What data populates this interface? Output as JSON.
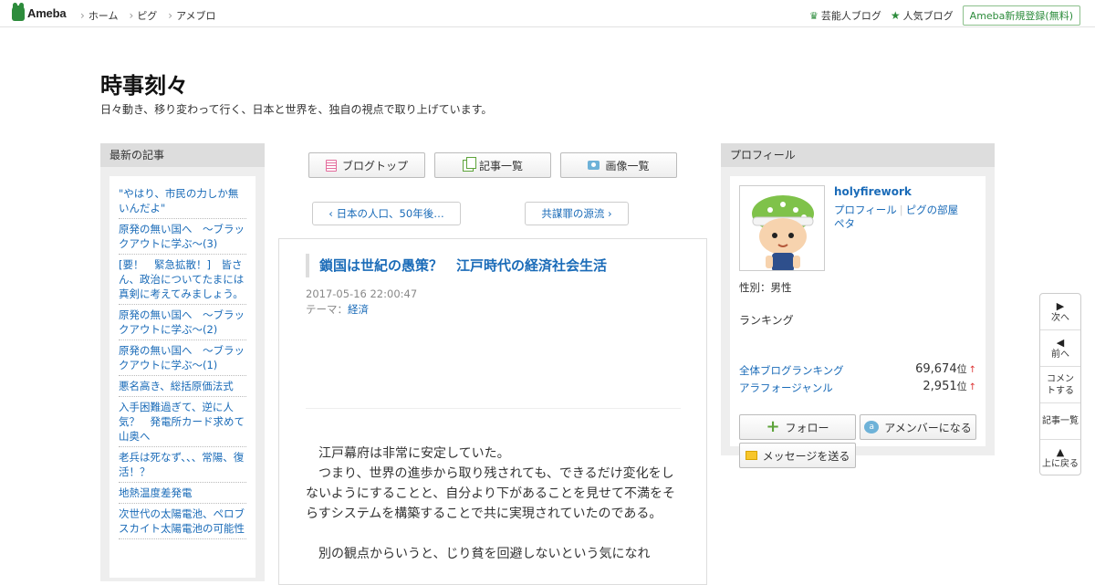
{
  "topbar": {
    "logo": "Ameba",
    "nav": [
      "ホーム",
      "ピグ",
      "アメブロ"
    ],
    "links": [
      {
        "label": "芸能人ブログ",
        "icon": "crown-icon"
      },
      {
        "label": "人気ブログ",
        "icon": "star-icon"
      }
    ],
    "register": "Ameba新規登録(無料)"
  },
  "blog": {
    "title": "時事刻々",
    "description": "日々動き、移り変わって行く、日本と世界を、独自の視点で取り上げています。"
  },
  "sidebar_left": {
    "heading": "最新の記事",
    "items": [
      "\"やはり、市民の力しか無いんだよ\"",
      "原発の無い国へ　～ブラックアウトに学ぶ～(3)",
      "[要！　緊急拡散！]　皆さん、政治についてたまには真剣に考えてみましょう。",
      "原発の無い国へ　～ブラックアウトに学ぶ～(2)",
      "原発の無い国へ　～ブラックアウトに学ぶ～(1)",
      "悪名高き、総括原価法式",
      "入手困難過ぎて、逆に人気？　発電所カード求めて山奥へ",
      "老兵は死なず、、、常陽、復活！？",
      "地熱温度差発電",
      "次世代の太陽電池、ペロブスカイト太陽電池の可能性"
    ]
  },
  "nav_buttons": {
    "blog_top": "ブログトップ",
    "article_list": "記事一覧",
    "image_list": "画像一覧"
  },
  "pager": {
    "prev": "日本の人口、50年後…",
    "next": "共謀罪の源流"
  },
  "article": {
    "title": "鎖国は世紀の愚策？　江戸時代の経済社会生活",
    "date": "2017-05-16 22:00:47",
    "theme_label": "テーマ：",
    "theme": "経済",
    "paragraphs": [
      "　江戸幕府は非常に安定していた。",
      "　つまり、世界の進歩から取り残されても、できるだけ変化をしないようにすることと、自分より下があることを見せて不満をそらすシステムを構築することで共に実現されていたのである。",
      "",
      "　別の観点からいうと、じり貧を回避しないという気になれ"
    ]
  },
  "profile": {
    "heading": "プロフィール",
    "username": "holyfirework",
    "link_profile": "プロフィール",
    "link_pig": "ピグの部屋",
    "link_peta": "ペタ",
    "gender": "性別：男性",
    "ranking_heading": "ランキング",
    "rankings": [
      {
        "label": "全体ブログランキング",
        "value": "69,674",
        "unit": "位",
        "trend": "↑"
      },
      {
        "label": "アラフォージャンル",
        "value": "2,951",
        "unit": "位",
        "trend": "↑"
      }
    ],
    "follow": "フォロー",
    "amember": "アメンバーになる",
    "message": "メッセージを送る"
  },
  "floatnav": {
    "next": "次へ",
    "prev": "前へ",
    "comment": "コメントする",
    "list": "記事一覧",
    "top": "上に戻る"
  },
  "colors": {
    "brand_green": "#2d8c3c",
    "link_blue": "#1a6bb8"
  }
}
